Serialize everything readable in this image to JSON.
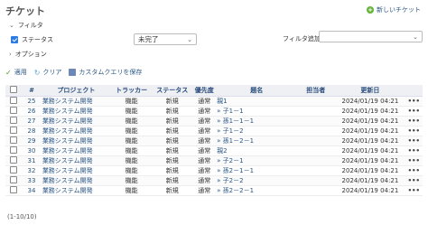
{
  "page": {
    "title": "チケット",
    "new_ticket": "新しいチケット"
  },
  "filter": {
    "toggle": "フィルタ",
    "status_label": "ステータス",
    "status_value": "未完了",
    "add_filter_label": "フィルタ追加",
    "options": "オプション"
  },
  "actions": {
    "apply": "適用",
    "clear": "クリア",
    "save": "カスタムクエリを保存"
  },
  "table": {
    "headers": [
      "#",
      "プロジェクト",
      "トラッカー",
      "ステータス",
      "優先度",
      "題名",
      "担当者",
      "更新日"
    ],
    "rows": [
      {
        "id": "25",
        "project": "業務システム開発",
        "tracker": "機能",
        "status": "新規",
        "priority": "通常",
        "subject": "親1",
        "assignee": "",
        "updated": "2024/01/19 04:21"
      },
      {
        "id": "26",
        "project": "業務システム開発",
        "tracker": "機能",
        "status": "新規",
        "priority": "通常",
        "subject": "» 子1－1",
        "assignee": "",
        "updated": "2024/01/19 04:21"
      },
      {
        "id": "27",
        "project": "業務システム開発",
        "tracker": "機能",
        "status": "新規",
        "priority": "通常",
        "subject": "» 孫1－1－1",
        "assignee": "",
        "updated": "2024/01/19 04:21"
      },
      {
        "id": "28",
        "project": "業務システム開発",
        "tracker": "機能",
        "status": "新規",
        "priority": "通常",
        "subject": "» 子1－2",
        "assignee": "",
        "updated": "2024/01/19 04:21"
      },
      {
        "id": "29",
        "project": "業務システム開発",
        "tracker": "機能",
        "status": "新規",
        "priority": "通常",
        "subject": "» 孫1－2－1",
        "assignee": "",
        "updated": "2024/01/19 04:21"
      },
      {
        "id": "30",
        "project": "業務システム開発",
        "tracker": "機能",
        "status": "新規",
        "priority": "通常",
        "subject": "親2",
        "assignee": "",
        "updated": "2024/01/19 04:21"
      },
      {
        "id": "31",
        "project": "業務システム開発",
        "tracker": "機能",
        "status": "新規",
        "priority": "通常",
        "subject": "» 子2－1",
        "assignee": "",
        "updated": "2024/01/19 04:21"
      },
      {
        "id": "32",
        "project": "業務システム開発",
        "tracker": "機能",
        "status": "新規",
        "priority": "通常",
        "subject": "» 孫2－1－1",
        "assignee": "",
        "updated": "2024/01/19 04:21"
      },
      {
        "id": "33",
        "project": "業務システム開発",
        "tracker": "機能",
        "status": "新規",
        "priority": "通常",
        "subject": "» 子2－2",
        "assignee": "",
        "updated": "2024/01/19 04:21"
      },
      {
        "id": "34",
        "project": "業務システム開発",
        "tracker": "機能",
        "status": "新規",
        "priority": "通常",
        "subject": "» 孫2－2－1",
        "assignee": "",
        "updated": "2024/01/19 04:21"
      }
    ]
  },
  "pager": {
    "text": "(1-10/10)"
  },
  "icons": {
    "more": "•••"
  }
}
